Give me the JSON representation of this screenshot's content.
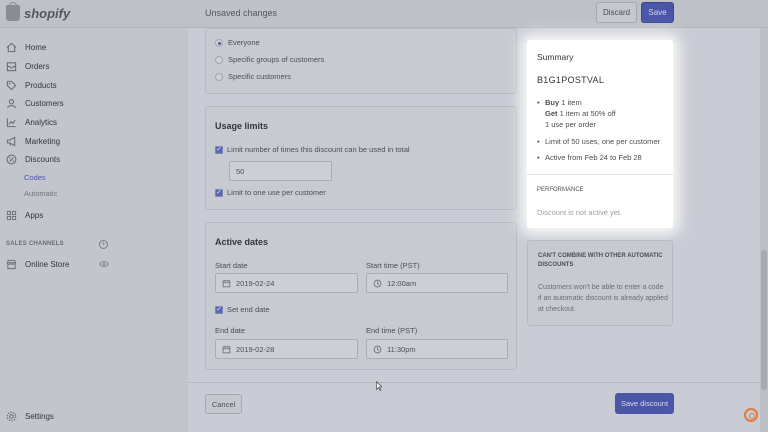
{
  "brand": {
    "name": "shopify"
  },
  "topbar": {
    "title": "Unsaved changes",
    "discard_label": "Discard",
    "save_label": "Save"
  },
  "sidebar": {
    "items": [
      {
        "label": "Home",
        "icon": "home-icon"
      },
      {
        "label": "Orders",
        "icon": "orders-icon"
      },
      {
        "label": "Products",
        "icon": "tag-icon"
      },
      {
        "label": "Customers",
        "icon": "person-icon"
      },
      {
        "label": "Analytics",
        "icon": "chart-icon"
      },
      {
        "label": "Marketing",
        "icon": "megaphone-icon"
      },
      {
        "label": "Discounts",
        "icon": "discount-icon"
      },
      {
        "label": "Apps",
        "icon": "apps-icon"
      }
    ],
    "discount_sub": [
      {
        "label": "Codes"
      },
      {
        "label": "Automatic"
      }
    ],
    "sales_channels_label": "SALES CHANNELS",
    "online_store_label": "Online Store",
    "settings_label": "Settings"
  },
  "eligibility": {
    "options": [
      {
        "label": "Everyone",
        "selected": true
      },
      {
        "label": "Specific groups of customers",
        "selected": false
      },
      {
        "label": "Specific customers",
        "selected": false
      }
    ]
  },
  "usage_limits": {
    "title": "Usage limits",
    "limit_total_label": "Limit number of times this discount can be used in total",
    "limit_total_value": "50",
    "limit_per_customer_label": "Limit to one use per customer"
  },
  "active_dates": {
    "title": "Active dates",
    "start_date_label": "Start date",
    "start_date": "2019-02-24",
    "start_time_label": "Start time (PST)",
    "start_time": "12:00am",
    "set_end_label": "Set end date",
    "end_date_label": "End date",
    "end_date": "2019-02-28",
    "end_time_label": "End time (PST)",
    "end_time": "11:30pm"
  },
  "summary": {
    "title": "Summary",
    "code": "B1G1POSTVAL",
    "buy_label": "Buy",
    "buy_text": "1 item",
    "get_label": "Get",
    "get_text": "1 item at 50% off",
    "use_text": "1 use per order",
    "limit_text": "Limit of 50 uses, one per customer",
    "active_text": "Active from Feb 24 to Feb 28",
    "performance_label": "PERFORMANCE",
    "performance_text": "Discount is not active yet."
  },
  "combine": {
    "title": "CAN'T COMBINE WITH OTHER AUTOMATIC DISCOUNTS",
    "text": "Customers won't be able to enter a code if an automatic discount is already applied at checkout."
  },
  "footer": {
    "cancel_label": "Cancel",
    "save_discount_label": "Save discount"
  },
  "colors": {
    "primary": "#4a56a8",
    "highlight": "#ffffff",
    "accent_badge": "#e07a3a"
  }
}
